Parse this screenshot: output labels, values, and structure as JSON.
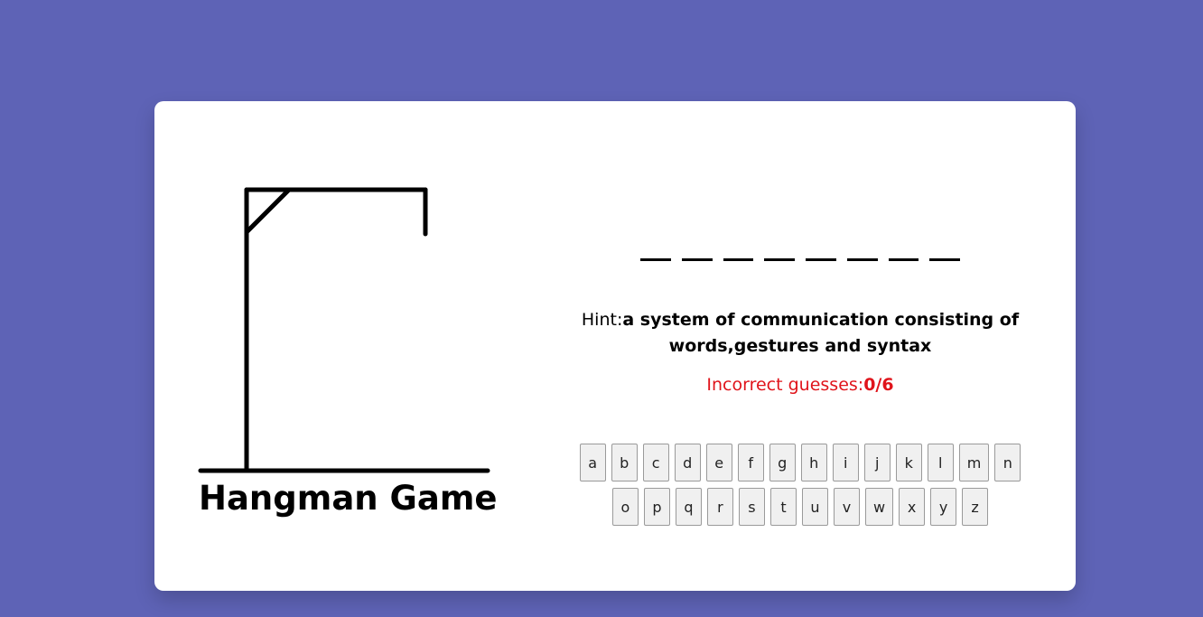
{
  "title": "Hangman Game",
  "word": {
    "blank_count": 8
  },
  "hint": {
    "label": "Hint:",
    "text": "a system of communication consisting of words,gestures and syntax"
  },
  "incorrect": {
    "label": "Incorrect guesses:",
    "count": "0/6"
  },
  "keyboard": {
    "row1": [
      "a",
      "b",
      "c",
      "d",
      "e",
      "f",
      "g",
      "h",
      "i",
      "j",
      "k",
      "l",
      "m",
      "n"
    ],
    "row2": [
      "o",
      "p",
      "q",
      "r",
      "s",
      "t",
      "u",
      "v",
      "w",
      "x",
      "y",
      "z"
    ]
  },
  "colors": {
    "background": "#5e63b6",
    "card": "#ffffff",
    "incorrect_text": "#e0141b",
    "key_bg": "#f0f0f0"
  }
}
